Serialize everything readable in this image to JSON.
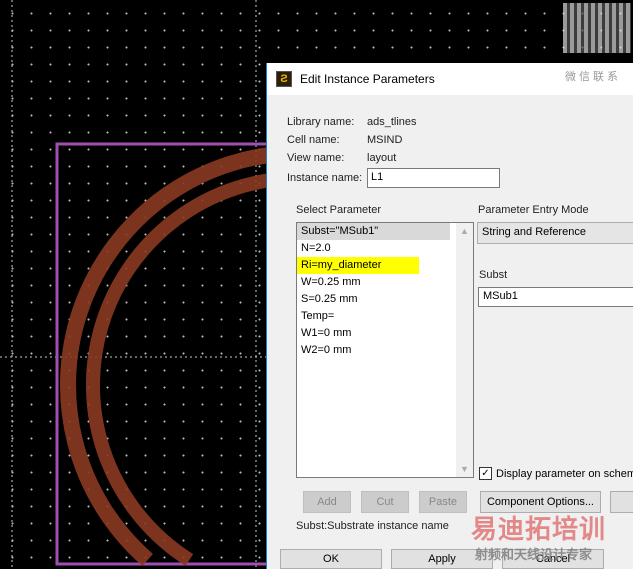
{
  "dialog": {
    "title": "Edit Instance Parameters",
    "library_label": "Library name:",
    "library_value": "ads_tlines",
    "cell_label": "Cell name:",
    "cell_value": "MSIND",
    "view_label": "View name:",
    "view_value": "layout",
    "instance_label": "Instance name:",
    "instance_value": "L1",
    "select_param_label": "Select Parameter",
    "params": [
      "Subst=\"MSub1\"",
      "N=2.0",
      "Ri=my_diameter",
      "W=0.25 mm",
      "S=0.25 mm",
      "Temp=",
      "W1=0 mm",
      "W2=0 mm"
    ],
    "entry_mode_label": "Parameter Entry Mode",
    "entry_mode_value": "String and Reference",
    "subst_label": "Subst",
    "subst_value": "MSub1",
    "display_checkbox_label": "Display parameter on schematic",
    "add": "Add",
    "cut": "Cut",
    "paste": "Paste",
    "component_options": "Component Options...",
    "description": "Subst:Substrate instance name",
    "ok": "OK",
    "apply": "Apply",
    "cancel": "Cancel"
  },
  "watermark": {
    "main": "易迪拓培训",
    "sub": "射频和天线设计专家",
    "qr_caption": "微信联系"
  }
}
